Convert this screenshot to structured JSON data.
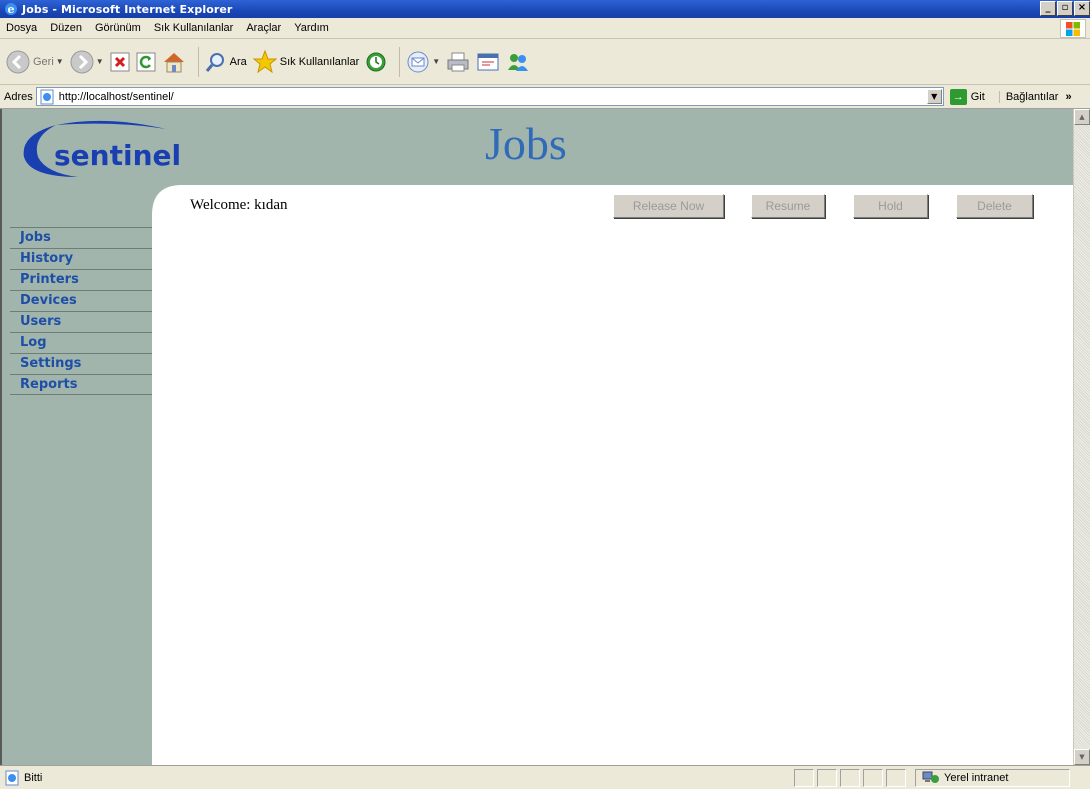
{
  "window": {
    "title": "Jobs - Microsoft Internet Explorer"
  },
  "menu": [
    "Dosya",
    "Düzen",
    "Görünüm",
    "Sık Kullanılanlar",
    "Araçlar",
    "Yardım"
  ],
  "toolbar": {
    "back_label": "Geri",
    "search_label": "Ara",
    "favorites_label": "Sık Kullanılanlar"
  },
  "address": {
    "label": "Adres",
    "url": "http://localhost/sentinel/",
    "go_label": "Git",
    "links_label": "Bağlantılar"
  },
  "page": {
    "logo_text": "sentinel",
    "title": "Jobs",
    "welcome": "Welcome: kıdan",
    "buttons": [
      "Release Now",
      "Resume",
      "Hold",
      "Delete"
    ],
    "nav": [
      "Jobs",
      "History",
      "Printers",
      "Devices",
      "Users",
      "Log",
      "Settings",
      "Reports"
    ]
  },
  "status": {
    "text": "Bitti",
    "zone": "Yerel intranet"
  },
  "colors": {
    "header_bg": "#a2b5ad",
    "nav_text": "#1d4fa6",
    "title_text": "#2f6bb8",
    "logo_blue": "#1a3fb0",
    "logo_dot": "#e03010"
  }
}
